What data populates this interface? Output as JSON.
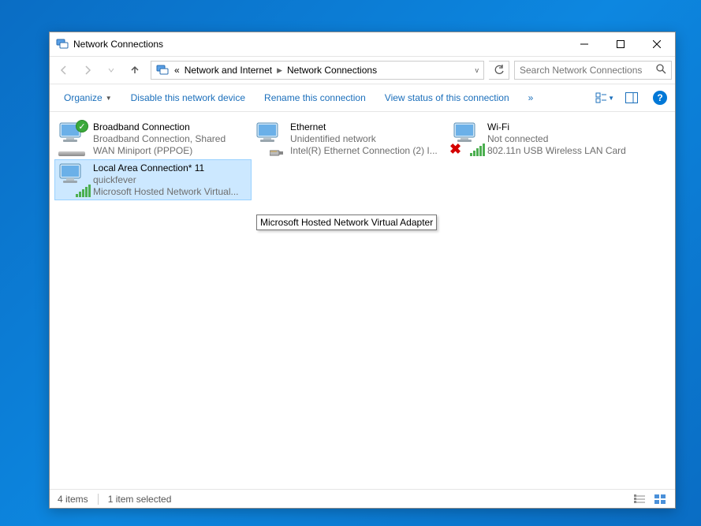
{
  "window": {
    "title": "Network Connections"
  },
  "breadcrumb": {
    "prefix": "«",
    "items": [
      "Network and Internet",
      "Network Connections"
    ]
  },
  "search": {
    "placeholder": "Search Network Connections"
  },
  "commands": {
    "organize": "Organize",
    "disable": "Disable this network device",
    "rename": "Rename this connection",
    "view_status": "View status of this connection",
    "overflow": "»"
  },
  "connections": [
    {
      "name": "Broadband Connection",
      "status": "Broadband Connection, Shared",
      "device": "WAN Miniport (PPPOE)",
      "icon": "monitor-modem",
      "overlay": "check",
      "selected": false
    },
    {
      "name": "Ethernet",
      "status": "Unidentified network",
      "device": "Intel(R) Ethernet Connection (2) I...",
      "icon": "monitor-ethernet",
      "overlay": null,
      "selected": false
    },
    {
      "name": "Wi-Fi",
      "status": "Not connected",
      "device": "802.11n USB Wireless LAN Card",
      "icon": "monitor-signal",
      "overlay": "x",
      "selected": false
    },
    {
      "name": "Local Area Connection* 11",
      "status": "quickfever",
      "device": "Microsoft Hosted Network Virtual...",
      "icon": "monitor-signal",
      "overlay": null,
      "selected": true
    }
  ],
  "tooltip": "Microsoft Hosted Network Virtual Adapter",
  "status": {
    "items_count": "4 items",
    "selected_count": "1 item selected"
  }
}
